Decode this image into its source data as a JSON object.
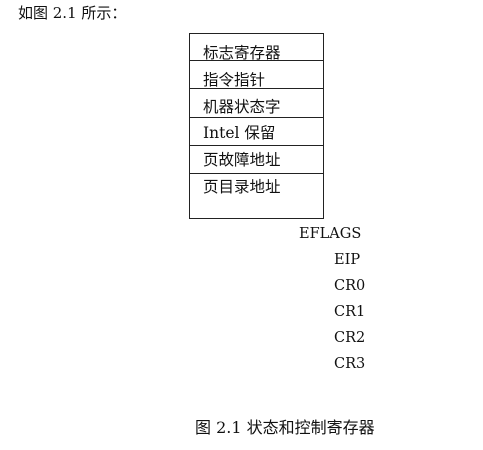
{
  "intro_text": "如图 2.1 所示：",
  "register_fields": [
    "标志寄存器",
    "指令指针",
    "机器状态字",
    "Intel 保留",
    "页故障地址",
    "页目录地址"
  ],
  "register_names": [
    "EFLAGS",
    "EIP",
    "CR0",
    "CR1",
    "CR2",
    "CR3"
  ],
  "caption": "图 2.1 状态和控制寄存器"
}
